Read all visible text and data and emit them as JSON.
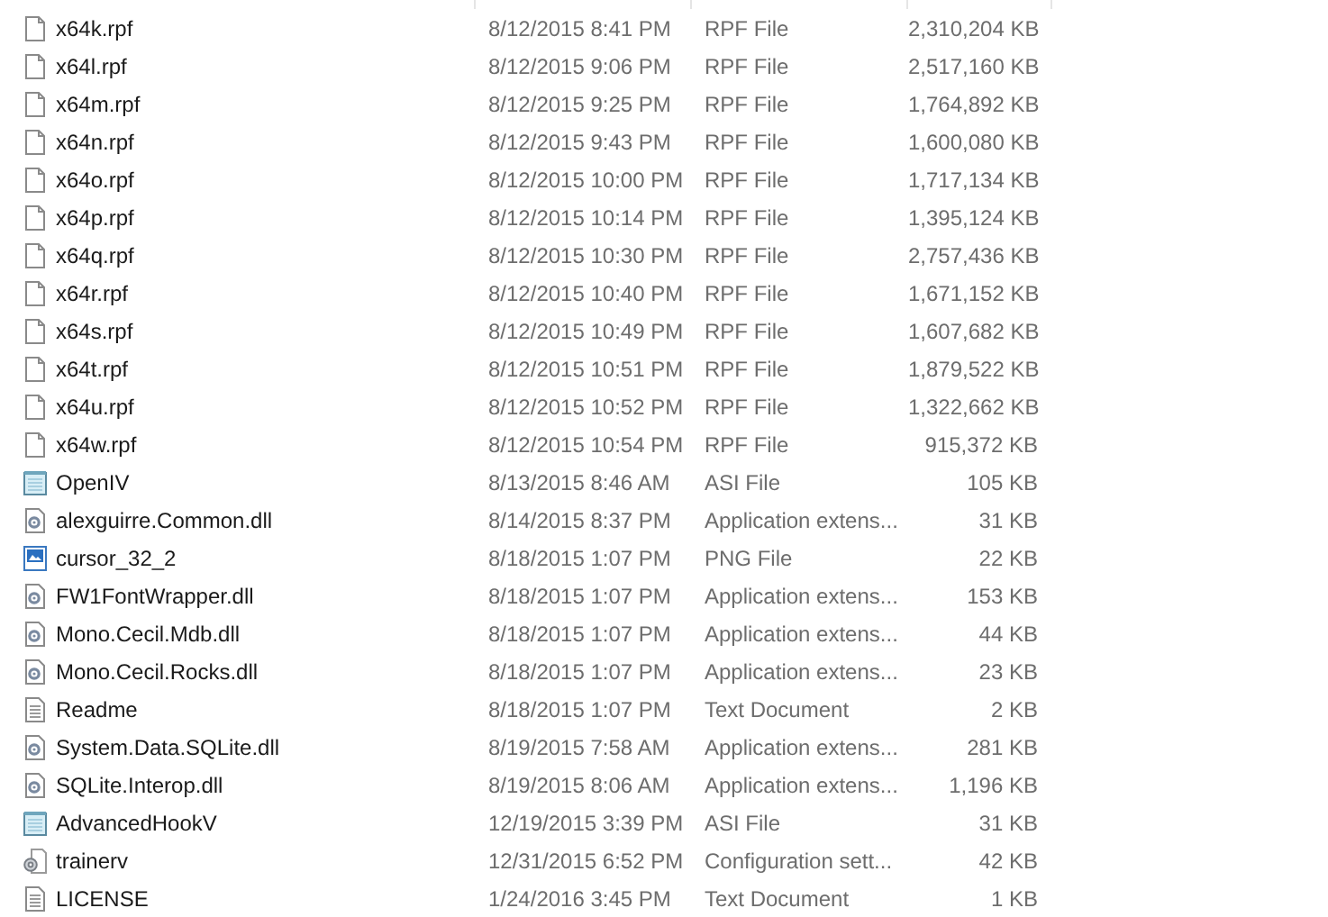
{
  "files": [
    {
      "kind": "blank",
      "name": "x64k.rpf",
      "date": "8/12/2015 8:41 PM",
      "type": "RPF File",
      "size": "2,310,204 KB"
    },
    {
      "kind": "blank",
      "name": "x64l.rpf",
      "date": "8/12/2015 9:06 PM",
      "type": "RPF File",
      "size": "2,517,160 KB"
    },
    {
      "kind": "blank",
      "name": "x64m.rpf",
      "date": "8/12/2015 9:25 PM",
      "type": "RPF File",
      "size": "1,764,892 KB"
    },
    {
      "kind": "blank",
      "name": "x64n.rpf",
      "date": "8/12/2015 9:43 PM",
      "type": "RPF File",
      "size": "1,600,080 KB"
    },
    {
      "kind": "blank",
      "name": "x64o.rpf",
      "date": "8/12/2015 10:00 PM",
      "type": "RPF File",
      "size": "1,717,134 KB"
    },
    {
      "kind": "blank",
      "name": "x64p.rpf",
      "date": "8/12/2015 10:14 PM",
      "type": "RPF File",
      "size": "1,395,124 KB"
    },
    {
      "kind": "blank",
      "name": "x64q.rpf",
      "date": "8/12/2015 10:30 PM",
      "type": "RPF File",
      "size": "2,757,436 KB"
    },
    {
      "kind": "blank",
      "name": "x64r.rpf",
      "date": "8/12/2015 10:40 PM",
      "type": "RPF File",
      "size": "1,671,152 KB"
    },
    {
      "kind": "blank",
      "name": "x64s.rpf",
      "date": "8/12/2015 10:49 PM",
      "type": "RPF File",
      "size": "1,607,682 KB"
    },
    {
      "kind": "blank",
      "name": "x64t.rpf",
      "date": "8/12/2015 10:51 PM",
      "type": "RPF File",
      "size": "1,879,522 KB"
    },
    {
      "kind": "blank",
      "name": "x64u.rpf",
      "date": "8/12/2015 10:52 PM",
      "type": "RPF File",
      "size": "1,322,662 KB"
    },
    {
      "kind": "blank",
      "name": "x64w.rpf",
      "date": "8/12/2015 10:54 PM",
      "type": "RPF File",
      "size": "915,372 KB"
    },
    {
      "kind": "asi",
      "name": "OpenIV",
      "date": "8/13/2015 8:46 AM",
      "type": "ASI File",
      "size": "105 KB"
    },
    {
      "kind": "dll",
      "name": "alexguirre.Common.dll",
      "date": "8/14/2015 8:37 PM",
      "type": "Application extens...",
      "size": "31 KB"
    },
    {
      "kind": "png",
      "name": "cursor_32_2",
      "date": "8/18/2015 1:07 PM",
      "type": "PNG File",
      "size": "22 KB"
    },
    {
      "kind": "dll",
      "name": "FW1FontWrapper.dll",
      "date": "8/18/2015 1:07 PM",
      "type": "Application extens...",
      "size": "153 KB"
    },
    {
      "kind": "dll",
      "name": "Mono.Cecil.Mdb.dll",
      "date": "8/18/2015 1:07 PM",
      "type": "Application extens...",
      "size": "44 KB"
    },
    {
      "kind": "dll",
      "name": "Mono.Cecil.Rocks.dll",
      "date": "8/18/2015 1:07 PM",
      "type": "Application extens...",
      "size": "23 KB"
    },
    {
      "kind": "txt",
      "name": "Readme",
      "date": "8/18/2015 1:07 PM",
      "type": "Text Document",
      "size": "2 KB"
    },
    {
      "kind": "dll",
      "name": "System.Data.SQLite.dll",
      "date": "8/19/2015 7:58 AM",
      "type": "Application extens...",
      "size": "281 KB"
    },
    {
      "kind": "dll",
      "name": "SQLite.Interop.dll",
      "date": "8/19/2015 8:06 AM",
      "type": "Application extens...",
      "size": "1,196 KB"
    },
    {
      "kind": "asi",
      "name": "AdvancedHookV",
      "date": "12/19/2015 3:39 PM",
      "type": "ASI File",
      "size": "31 KB"
    },
    {
      "kind": "cfg",
      "name": "trainerv",
      "date": "12/31/2015 6:52 PM",
      "type": "Configuration sett...",
      "size": "42 KB"
    },
    {
      "kind": "txt",
      "name": "LICENSE",
      "date": "1/24/2016 3:45 PM",
      "type": "Text Document",
      "size": "1 KB"
    }
  ]
}
